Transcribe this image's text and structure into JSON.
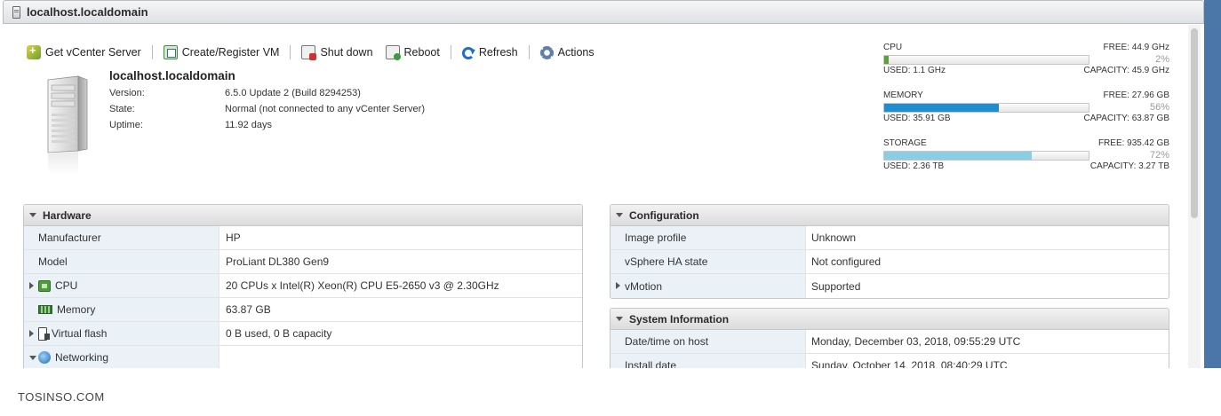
{
  "window": {
    "title": "localhost.localdomain"
  },
  "toolbar": {
    "get_vcenter": "Get vCenter Server",
    "create_register_vm": "Create/Register VM",
    "shut_down": "Shut down",
    "reboot": "Reboot",
    "refresh": "Refresh",
    "actions": "Actions"
  },
  "host": {
    "name": "localhost.localdomain",
    "version_label": "Version:",
    "version_value": "6.5.0 Update 2 (Build 8294253)",
    "state_label": "State:",
    "state_value": "Normal (not connected to any vCenter Server)",
    "uptime_label": "Uptime:",
    "uptime_value": "11.92 days"
  },
  "resources": {
    "cpu": {
      "label": "CPU",
      "free": "FREE: 44.9 GHz",
      "percent_text": "2%",
      "percent": 2,
      "used": "USED: 1.1 GHz",
      "capacity": "CAPACITY: 45.9 GHz",
      "color": "#5aa13a"
    },
    "memory": {
      "label": "MEMORY",
      "free": "FREE: 27.96 GB",
      "percent_text": "56%",
      "percent": 56,
      "used": "USED: 35.91 GB",
      "capacity": "CAPACITY: 63.87 GB",
      "color": "#1e8ed0"
    },
    "storage": {
      "label": "STORAGE",
      "free": "FREE: 935.42 GB",
      "percent_text": "72%",
      "percent": 72,
      "used": "USED: 2.36 TB",
      "capacity": "CAPACITY: 3.27 TB",
      "color": "#8ccde6"
    }
  },
  "hardware": {
    "title": "Hardware",
    "rows": [
      {
        "key": "Manufacturer",
        "value": "HP"
      },
      {
        "key": "Model",
        "value": "ProLiant DL380 Gen9"
      },
      {
        "key": "CPU",
        "value": "20 CPUs x Intel(R) Xeon(R) CPU E5-2650 v3 @ 2.30GHz"
      },
      {
        "key": "Memory",
        "value": "63.87 GB"
      },
      {
        "key": "Virtual flash",
        "value": "0 B used, 0 B capacity"
      },
      {
        "key": "Networking",
        "value": ""
      }
    ]
  },
  "configuration": {
    "title": "Configuration",
    "rows": [
      {
        "key": "Image profile",
        "value": "Unknown"
      },
      {
        "key": "vSphere HA state",
        "value": "Not configured"
      },
      {
        "key": "vMotion",
        "value": "Supported"
      }
    ]
  },
  "system_info": {
    "title": "System Information",
    "rows": [
      {
        "key": "Date/time on host",
        "value": "Monday, December 03, 2018, 09:55:29 UTC"
      },
      {
        "key": "Install date",
        "value": "Sunday, October 14, 2018, 08:40:29 UTC"
      }
    ]
  },
  "watermark": "TOSINSO.COM"
}
